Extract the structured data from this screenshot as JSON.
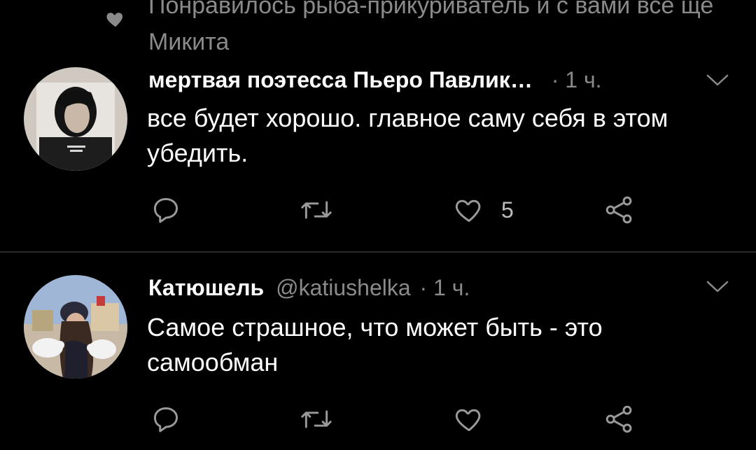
{
  "liked_header": {
    "text": "Понравилось рыба-прикуриватель и с вами все ще Микита",
    "icon": "heart-icon"
  },
  "tweets": [
    {
      "author": "мертвая поэтесса Пьеро Павлик…",
      "handle": "",
      "separator": "·",
      "time": "1 ч.",
      "text": "все будет хорошо. главное саму себя в этом убедить.",
      "likes": "5",
      "icons": [
        "reply-icon",
        "retweet-icon",
        "heart-icon",
        "share-icon",
        "chevron-down-icon"
      ]
    },
    {
      "author": "Катюшель",
      "handle": "@katiushelka",
      "separator": "·",
      "time": "1 ч.",
      "text": "Самое страшное, что может быть - это самообман",
      "likes": "",
      "icons": [
        "reply-icon",
        "retweet-icon",
        "heart-icon",
        "share-icon",
        "chevron-down-icon"
      ]
    }
  ],
  "colors": {
    "background": "#000000",
    "text": "#ffffff",
    "muted": "#8a8a8a",
    "divider": "#2a2a2a"
  }
}
